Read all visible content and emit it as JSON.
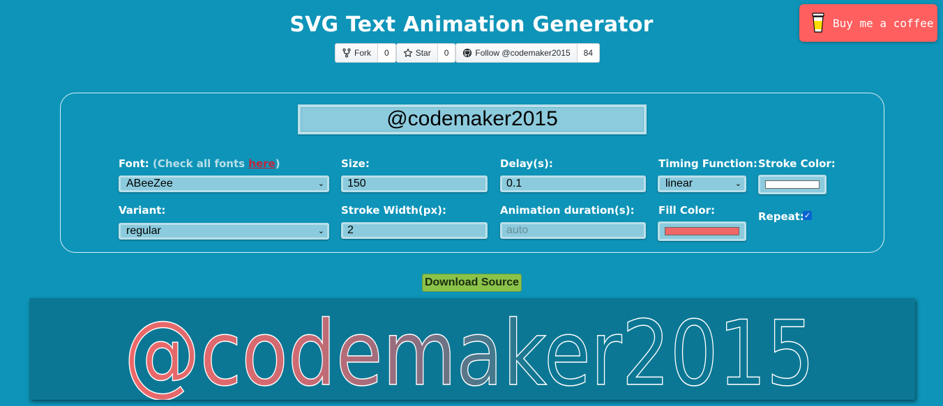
{
  "header": {
    "title": "SVG Text Animation Generator",
    "github": {
      "fork_label": "Fork",
      "fork_count": "0",
      "star_label": "Star",
      "star_count": "0",
      "follow_label": "Follow @codemaker2015",
      "follow_count": "84"
    },
    "coffee_label": "Buy me a coffee"
  },
  "form": {
    "text_value": "@codemaker2015",
    "font": {
      "label": "Font:",
      "hint_prefix": "(Check all fonts ",
      "hint_link": "here",
      "hint_suffix": ")",
      "value": "ABeeZee"
    },
    "size": {
      "label": "Size:",
      "value": "150"
    },
    "delay": {
      "label": "Delay(s):",
      "value": "0.1"
    },
    "timing": {
      "label": "Timing Function:",
      "value": "linear"
    },
    "stroke_color": {
      "label": "Stroke Color:",
      "value": "#ffffff"
    },
    "variant": {
      "label": "Variant:",
      "value": "regular"
    },
    "stroke_width": {
      "label": "Stroke Width(px):",
      "value": "2"
    },
    "duration": {
      "label": "Animation duration(s):",
      "placeholder": "auto"
    },
    "fill_color": {
      "label": "Fill Color:",
      "value": "#ef6868"
    },
    "repeat": {
      "label": "Repeat:",
      "checked": true
    }
  },
  "download_label": "Download Source",
  "preview": {
    "text": "@codemaker2015",
    "fill_start": "#ef6868",
    "stroke_color": "#ffffff"
  },
  "colors": {
    "background": "#0e94b8",
    "accent_coffee": "#ff5f5f",
    "download_button": "#8bc34a",
    "preview_background": "#0b7794"
  }
}
